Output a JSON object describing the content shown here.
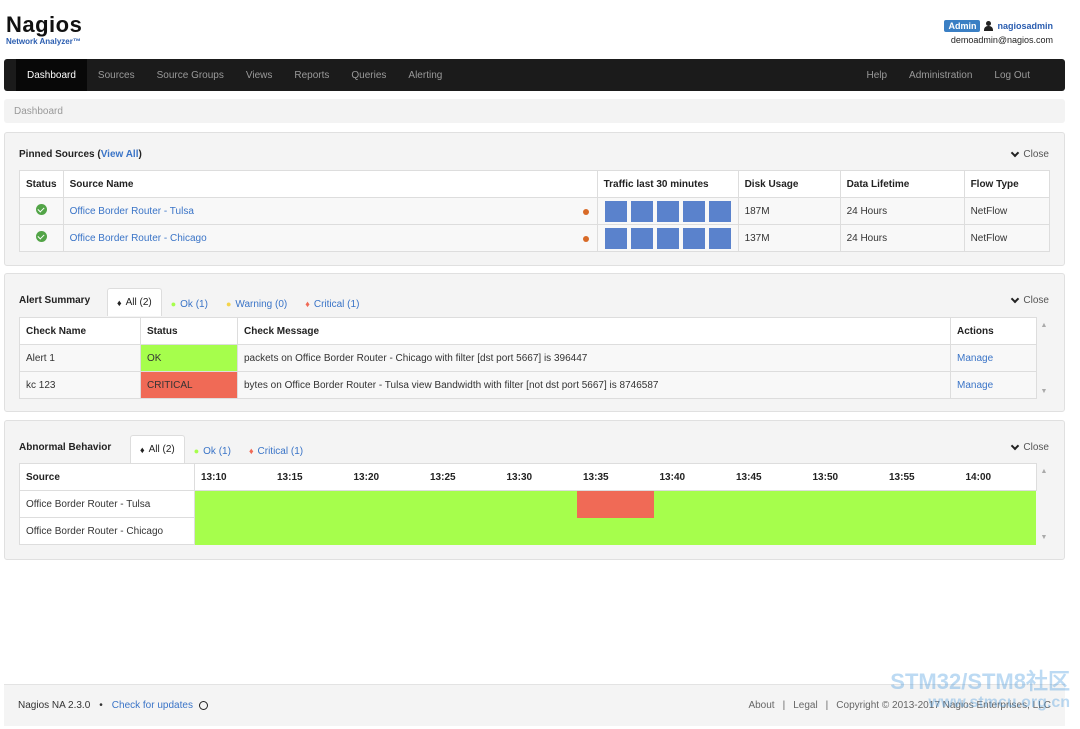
{
  "app": {
    "logo_main": "Nagios",
    "logo_sub": "Network Analyzer™"
  },
  "user": {
    "badge": "Admin",
    "name": "nagiosadmin",
    "email": "demoadmin@nagios.com"
  },
  "nav": {
    "left": [
      "Dashboard",
      "Sources",
      "Source Groups",
      "Views",
      "Reports",
      "Queries",
      "Alerting"
    ],
    "right": [
      "Help",
      "Administration",
      "Log Out"
    ]
  },
  "breadcrumb": "Dashboard",
  "pinned": {
    "title": "Pinned Sources (",
    "view_all": "View All",
    "title_end": ")",
    "close": "Close",
    "headers": [
      "Status",
      "Source Name",
      "Traffic last 30 minutes",
      "Disk Usage",
      "Data Lifetime",
      "Flow Type"
    ],
    "rows": [
      {
        "name": "Office Border Router - Tulsa",
        "disk": "187M",
        "lifetime": "24 Hours",
        "flow": "NetFlow"
      },
      {
        "name": "Office Border Router - Chicago",
        "disk": "137M",
        "lifetime": "24 Hours",
        "flow": "NetFlow"
      }
    ]
  },
  "alerts": {
    "title": "Alert Summary",
    "close": "Close",
    "tabs": [
      "All (2)",
      "Ok (1)",
      "Warning (0)",
      "Critical (1)"
    ],
    "headers": [
      "Check Name",
      "Status",
      "Check Message",
      "Actions"
    ],
    "rows": [
      {
        "name": "Alert 1",
        "status": "OK",
        "message": "packets on Office Border Router - Chicago with filter [dst port 5667] is 396447",
        "action": "Manage"
      },
      {
        "name": "kc 123",
        "status": "CRITICAL",
        "message": "bytes on Office Border Router - Tulsa view Bandwidth with filter [not dst port 5667] is 8746587",
        "action": "Manage"
      }
    ]
  },
  "abnormal": {
    "title": "Abnormal Behavior",
    "close": "Close",
    "tabs": [
      "All (2)",
      "Ok (1)",
      "Critical (1)"
    ],
    "source_header": "Source",
    "times": [
      "13:10",
      "13:15",
      "13:20",
      "13:25",
      "13:30",
      "13:35",
      "13:40",
      "13:45",
      "13:50",
      "13:55",
      "14:00"
    ],
    "rows": [
      {
        "name": "Office Border Router - Tulsa",
        "critical_slot": "13:35"
      },
      {
        "name": "Office Border Router - Chicago"
      }
    ]
  },
  "footer": {
    "version": "Nagios NA 2.3.0",
    "sep": "•",
    "check_updates": "Check for updates",
    "about": "About",
    "legal": "Legal",
    "copyright": "Copyright © 2013-2017 Nagios Enterprises, LLC"
  },
  "watermark": {
    "line1": "STM32/STM8社区",
    "line2": "www.stmcu.org.cn"
  },
  "colors": {
    "ok": "#a6fe4c",
    "critical": "#f06a56",
    "warning": "#f5d44a",
    "traffic": "#5a82cc"
  }
}
